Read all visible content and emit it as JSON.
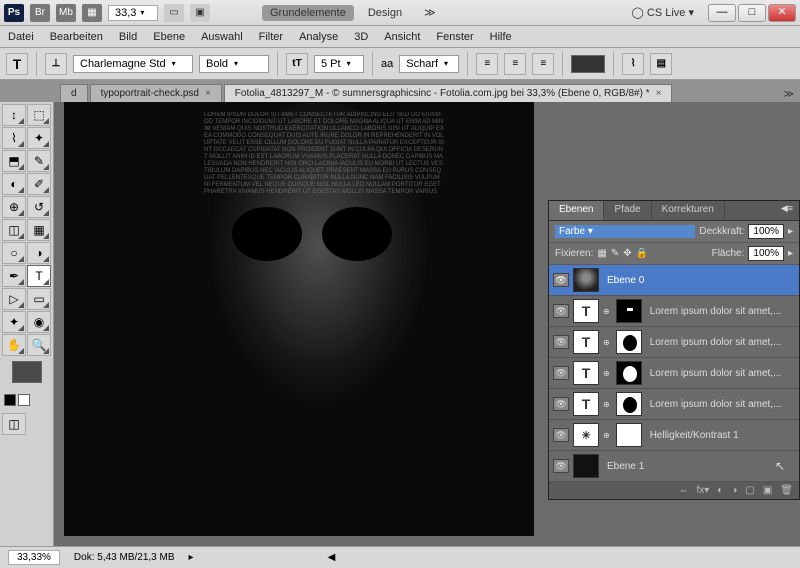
{
  "title": {
    "zoom": "33,3",
    "tab1": "Grundelemente",
    "tab2": "Design",
    "cslive": "CS Live"
  },
  "menu": [
    "Datei",
    "Bearbeiten",
    "Bild",
    "Ebene",
    "Auswahl",
    "Filter",
    "Analyse",
    "3D",
    "Ansicht",
    "Fenster",
    "Hilfe"
  ],
  "opt": {
    "font": "Charlemagne Std",
    "weight": "Bold",
    "size": "5 Pt",
    "aa_label": "aa",
    "sharp": "Scharf"
  },
  "doctabs": {
    "t1": "d",
    "t2": "typoportrait-check.psd",
    "t3": "Fotolia_4813297_M - © sumnersgraphicsinc - Fotolia.com.jpg bei 33,3% (Ebene 0, RGB/8#) *"
  },
  "panel": {
    "tabs": [
      "Ebenen",
      "Pfade",
      "Korrekturen"
    ],
    "blend": "Farbe",
    "opacity_label": "Deckkraft:",
    "opacity_val": "100%",
    "lock_label": "Fixieren:",
    "fill_label": "Fläche:",
    "fill_val": "100%",
    "layers": [
      {
        "name": "Ebene 0"
      },
      {
        "name": "Lorem ipsum dolor sit amet,..."
      },
      {
        "name": "Lorem ipsum dolor sit amet,..."
      },
      {
        "name": "Lorem ipsum dolor sit amet,..."
      },
      {
        "name": "Lorem ipsum dolor sit amet,..."
      },
      {
        "name": "Helligkeit/Kontrast 1"
      },
      {
        "name": "Ebene 1"
      }
    ]
  },
  "status": {
    "zoom": "33,33%",
    "doc": "Dok: 5,43 MB/21,3 MB"
  },
  "icons": {
    "T": "T",
    "ps": "Ps",
    "br": "Br",
    "mb": "Mb"
  }
}
